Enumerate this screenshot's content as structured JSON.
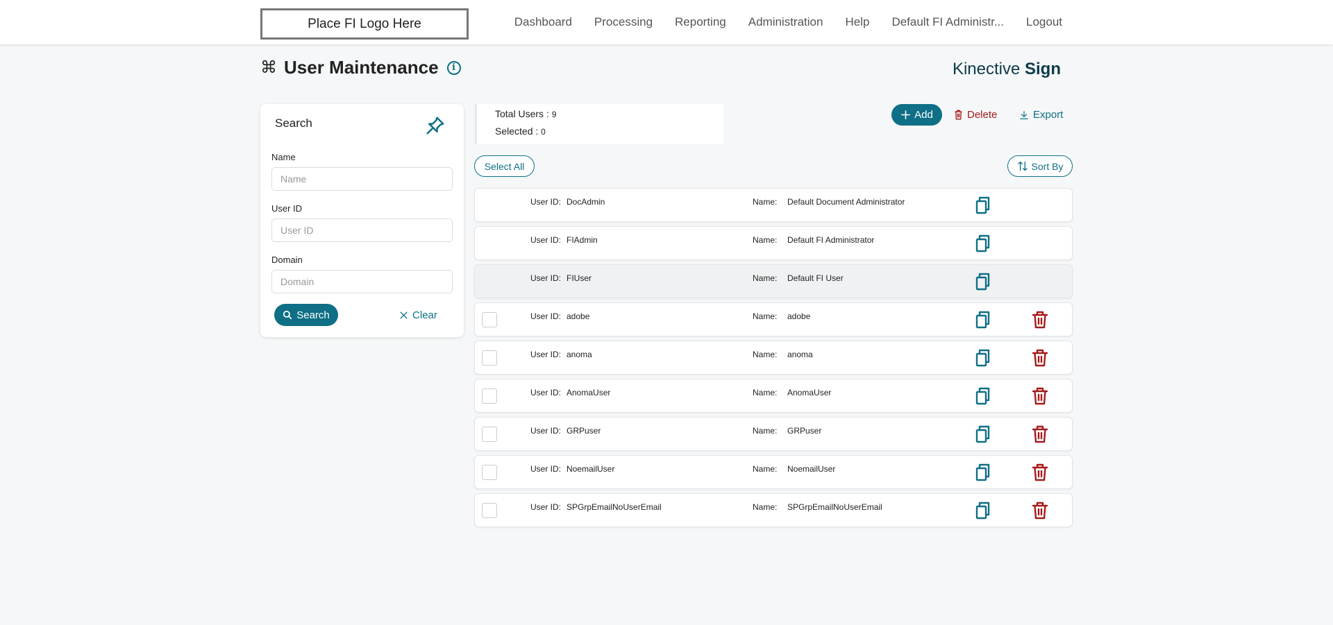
{
  "header": {
    "logo_text": "Place FI Logo Here",
    "nav": [
      "Dashboard",
      "Processing",
      "Reporting",
      "Administration",
      "Help",
      "Default FI Administr...",
      "Logout"
    ]
  },
  "page": {
    "title": "User Maintenance",
    "brand_light": "Kinective ",
    "brand_bold": "Sign"
  },
  "search": {
    "title": "Search",
    "name_label": "Name",
    "name_placeholder": "Name",
    "name_value": "",
    "userid_label": "User ID",
    "userid_placeholder": "User ID",
    "userid_value": "",
    "domain_label": "Domain",
    "domain_placeholder": "Domain",
    "domain_value": "",
    "search_label": "Search",
    "clear_label": "Clear"
  },
  "stats": {
    "total_label": "Total Users : ",
    "total_value": "9",
    "selected_label": "Selected : ",
    "selected_value": "0"
  },
  "actions": {
    "add_label": "Add",
    "delete_label": "Delete",
    "export_label": "Export",
    "select_all_label": "Select All",
    "sort_label": "Sort By"
  },
  "labels": {
    "user_id": "User ID:",
    "name": "Name:"
  },
  "users": [
    {
      "user_id": "DocAdmin",
      "name": "Default Document Administrator",
      "selectable": false,
      "deletable": false,
      "shaded": false
    },
    {
      "user_id": "FIAdmin",
      "name": "Default FI Administrator",
      "selectable": false,
      "deletable": false,
      "shaded": false
    },
    {
      "user_id": "FIUser",
      "name": "Default FI User",
      "selectable": false,
      "deletable": false,
      "shaded": true
    },
    {
      "user_id": "adobe",
      "name": "adobe",
      "selectable": true,
      "deletable": true,
      "shaded": false
    },
    {
      "user_id": "anoma",
      "name": "anoma",
      "selectable": true,
      "deletable": true,
      "shaded": false
    },
    {
      "user_id": "AnomaUser",
      "name": "AnomaUser",
      "selectable": true,
      "deletable": true,
      "shaded": false
    },
    {
      "user_id": "GRPuser",
      "name": "GRPuser",
      "selectable": true,
      "deletable": true,
      "shaded": false
    },
    {
      "user_id": "NoemailUser",
      "name": "NoemailUser",
      "selectable": true,
      "deletable": true,
      "shaded": false
    },
    {
      "user_id": "SPGrpEmailNoUserEmail",
      "name": "SPGrpEmailNoUserEmail",
      "selectable": true,
      "deletable": true,
      "shaded": false
    }
  ],
  "colors": {
    "accent": "#0e6f86",
    "danger": "#a51b1b",
    "brand_dark": "#0c3b49"
  },
  "icons": {
    "title": "command-icon",
    "info": "info-icon",
    "pin": "pin-icon",
    "search": "search-icon",
    "clear": "close-icon",
    "add": "plus-icon",
    "delete": "trash-icon",
    "export": "download-icon",
    "sort": "sort-icon",
    "copy": "copy-icon"
  }
}
